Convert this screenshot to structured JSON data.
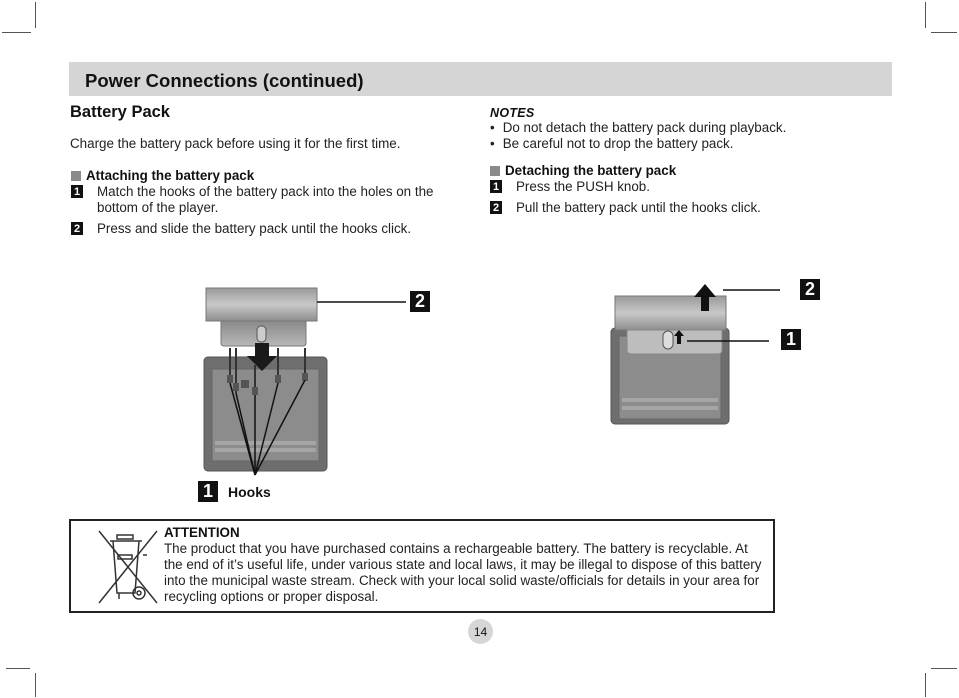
{
  "header": {
    "title": "Power Connections (continued)"
  },
  "section": {
    "title": "Battery Pack",
    "intro": "Charge the battery pack before using it for the first time."
  },
  "attaching": {
    "title": "Attaching the battery pack",
    "steps": [
      {
        "num": "1",
        "text": "Match the hooks of the battery pack into the holes on the bottom of the player."
      },
      {
        "num": "2",
        "text": "Press and slide the battery pack until the hooks click."
      }
    ]
  },
  "notes": {
    "title": "NOTES",
    "items": [
      "Do not detach the battery pack during playback.",
      "Be careful not to drop the battery pack."
    ]
  },
  "detaching": {
    "title": "Detaching the battery pack",
    "steps": [
      {
        "num": "1",
        "text": "Press the PUSH knob."
      },
      {
        "num": "2",
        "text": "Pull the battery pack until the hooks click."
      }
    ]
  },
  "figure_attach": {
    "callout_top": "2",
    "callout_hooks_num": "1",
    "callout_hooks_label": "Hooks"
  },
  "figure_detach": {
    "callout_top": "2",
    "callout_knob": "1"
  },
  "attention": {
    "icon": "crossed-out-wheelie-bin-icon",
    "title": "ATTENTION",
    "body": "The product that you have purchased contains a rechargeable battery. The battery is recyclable. At the end of it’s useful life, under various state and local laws, it may be illegal to dispose of this battery into the municipal waste stream. Check with your local solid waste/officials for details in your area for recycling options or proper disposal."
  },
  "page": {
    "number": "14"
  }
}
